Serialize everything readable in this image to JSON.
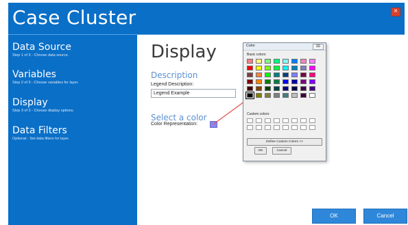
{
  "window": {
    "title": "Case Cluster",
    "close_symbol": "×"
  },
  "sidebar": {
    "steps": [
      {
        "title": "Data Source",
        "subtitle": "Step 1 of 3 - Choose data source."
      },
      {
        "title": "Variables",
        "subtitle": "Step 2 of 3 - Choose variables for layer."
      },
      {
        "title": "Display",
        "subtitle": "Step 3 of 3 - Choose display options."
      },
      {
        "title": "Data Filters",
        "subtitle": "Optional - Set data filters for layer."
      }
    ]
  },
  "main": {
    "title": "Display",
    "description_heading": "Description",
    "legend_label": "Legend Description:",
    "legend_value": "Legend Example",
    "color_heading": "Select a color",
    "color_label": "Color Representation:",
    "selected_color": "#8a86e8",
    "ok_label": "OK",
    "cancel_label": "Cancel"
  },
  "color_dialog": {
    "title": "Color",
    "close_symbol": "⌧",
    "basic_label": "Basic colors:",
    "custom_label": "Custom colors:",
    "define_label": "Define Custom Colors >>",
    "ok_label": "OK",
    "cancel_label": "Cancel",
    "basic_colors": [
      "#ff8080",
      "#ffff80",
      "#80ff80",
      "#00ff80",
      "#80ffff",
      "#0080ff",
      "#ff80c0",
      "#ff80ff",
      "#ff0000",
      "#ffff00",
      "#80ff00",
      "#00ff40",
      "#00ffff",
      "#0080c0",
      "#8080c0",
      "#ff00ff",
      "#804040",
      "#ff8040",
      "#00ff00",
      "#008080",
      "#004080",
      "#8080ff",
      "#800040",
      "#ff0080",
      "#800000",
      "#ff8000",
      "#008000",
      "#008040",
      "#0000ff",
      "#0000a0",
      "#800080",
      "#8000ff",
      "#400000",
      "#804000",
      "#004000",
      "#004040",
      "#000080",
      "#000040",
      "#400040",
      "#400080",
      "#000000",
      "#808000",
      "#808040",
      "#808080",
      "#408080",
      "#c0c0c0",
      "#400040",
      "#ffffff"
    ],
    "selected_index": 40,
    "custom_slots": 16
  }
}
